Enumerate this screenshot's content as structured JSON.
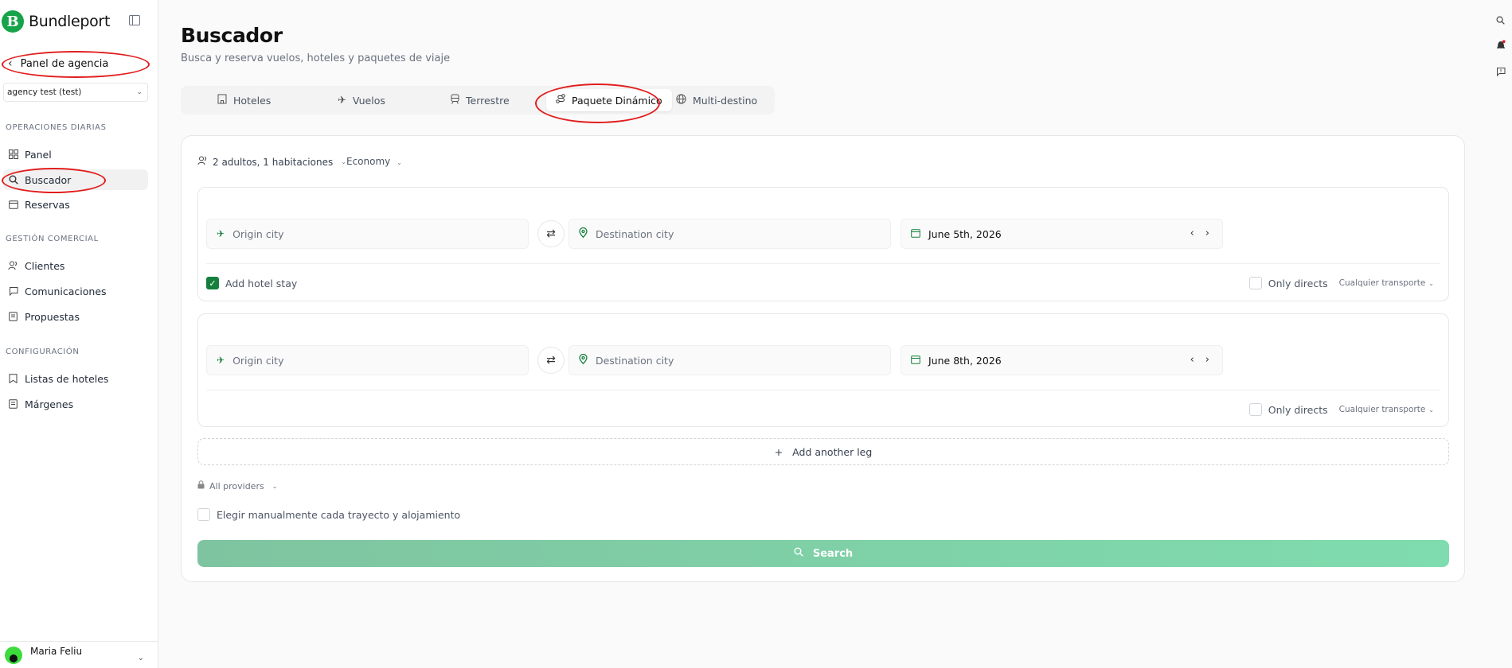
{
  "app": {
    "brand": "Bundleport",
    "logo_letter": "B"
  },
  "sidebar": {
    "back_label": "Panel de agencia",
    "agency": "agency test (test)",
    "sections": [
      {
        "label": "OPERACIONES DIARIAS",
        "items": [
          {
            "label": "Panel",
            "icon": "grid-icon"
          },
          {
            "label": "Buscador",
            "icon": "search-icon",
            "active": true
          },
          {
            "label": "Reservas",
            "icon": "calendar-icon"
          }
        ]
      },
      {
        "label": "GESTIÓN COMERCIAL",
        "items": [
          {
            "label": "Clientes",
            "icon": "users-icon"
          },
          {
            "label": "Comunicaciones",
            "icon": "chat-icon"
          },
          {
            "label": "Propuestas",
            "icon": "document-icon"
          }
        ]
      },
      {
        "label": "CONFIGURACIÓN",
        "items": [
          {
            "label": "Listas de hoteles",
            "icon": "bookmark-icon"
          },
          {
            "label": "Márgenes",
            "icon": "document-icon"
          }
        ]
      }
    ],
    "user": {
      "name": "Maria Feliu"
    }
  },
  "main": {
    "title": "Buscador",
    "subtitle": "Busca y reserva vuelos, hoteles y paquetes de viaje",
    "tabs": [
      {
        "label": "Hoteles",
        "icon": "building-icon"
      },
      {
        "label": "Vuelos",
        "icon": "plane-icon"
      },
      {
        "label": "Terrestre",
        "icon": "train-icon"
      },
      {
        "label": "Paquete Dinámico",
        "icon": "route-icon",
        "active": true
      },
      {
        "label": "Multi-destino",
        "icon": "globe-icon"
      }
    ],
    "passengers": "2 adultos, 1 habitaciones",
    "cabin": "Economy",
    "legs": [
      {
        "origin_placeholder": "Origin city",
        "destination_placeholder": "Destination city",
        "date": "June 5th, 2026",
        "hotel_label": "Add hotel stay",
        "hotel_checked": true,
        "directs_label": "Only directs",
        "transport": "Cualquier transporte"
      },
      {
        "origin_placeholder": "Origin city",
        "destination_placeholder": "Destination city",
        "date": "June 8th, 2026",
        "directs_label": "Only directs",
        "transport": "Cualquier transporte"
      }
    ],
    "add_leg": "Add another leg",
    "providers": "All providers",
    "manual_label": "Elegir manualmente cada trayecto y alojamiento",
    "search_label": "Search"
  },
  "colors": {
    "accent": "#15803d",
    "search_button": "#7fd4a8",
    "annotation": "#e11d1d"
  }
}
